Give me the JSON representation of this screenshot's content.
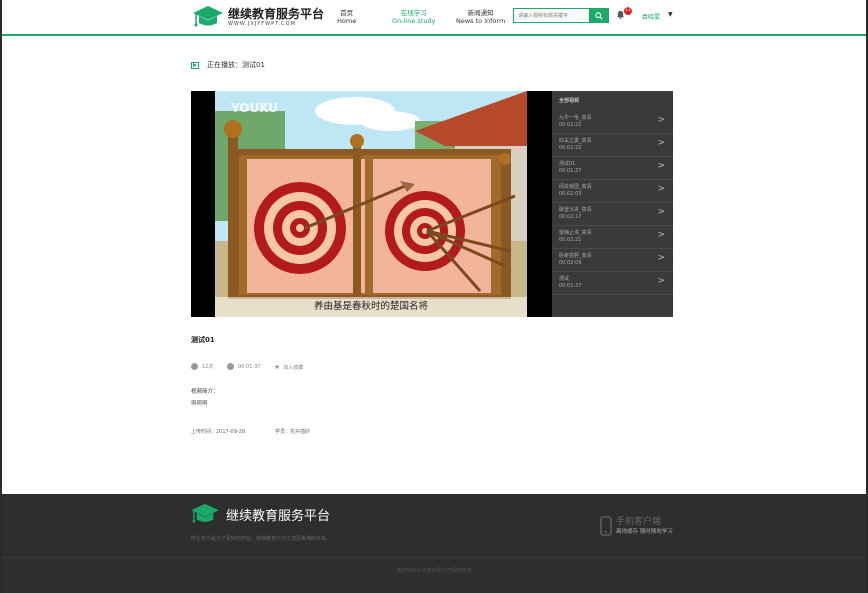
{
  "header": {
    "logo_title": "继续教育服务平台",
    "logo_subtitle": "WWW.JXJYFWPT.COM",
    "nav": [
      {
        "label": "首页",
        "sub": "Home",
        "active": false
      },
      {
        "label": "在线学习",
        "sub": "On-line study",
        "active": true
      },
      {
        "label": "新闻通知",
        "sub": "News to inform",
        "active": false
      }
    ],
    "search_placeholder": "请输入视频标题关键字",
    "notification_count": "13",
    "username": "袁晓雯"
  },
  "playing": {
    "prefix": "正在播放：",
    "name": "测试01"
  },
  "video": {
    "watermark": "YOUKU",
    "subtitle": "养由基是春秋时的楚国名将"
  },
  "playlist": {
    "title": "全部视频",
    "items": [
      {
        "name": "九牛一毛_高清",
        "duration": "00:02:22"
      },
      {
        "name": "匹夫之勇_高清",
        "duration": "00:02:22"
      },
      {
        "name": "测试01",
        "duration": "00:01:37"
      },
      {
        "name": "闭关锁国_高清",
        "duration": "00:02:03"
      },
      {
        "name": "破釜沉舟_高清",
        "duration": "00:02:17"
      },
      {
        "name": "望梅止渴_高清",
        "duration": "00:02:21"
      },
      {
        "name": "卧薪尝胆_高清",
        "duration": "00:02:09"
      },
      {
        "name": "测试",
        "duration": "00:01:37"
      }
    ]
  },
  "info": {
    "title": "测试01",
    "views": "12次",
    "duration": "00:01:37",
    "favorite": "加入收藏",
    "intro_label": "视频简介：",
    "intro_text": "啊啊啊",
    "upload_time": "上传时间：2017-09-28",
    "teacher": "学员：花卉插砂"
  },
  "footer": {
    "title": "继续教育服务平台",
    "slogan": "终生学习是为了更好的开始，继续教育只为了迎更美满的未来。",
    "mobile_title": "手机客户端",
    "mobile_sub": "离线缓存 随时随地学习",
    "copyright": "版权所有©科技有限公司版权所有"
  },
  "colors": {
    "accent": "#1aab6a",
    "footer_bg": "#2e2e2e",
    "playlist_bg": "#3a3a3a"
  }
}
